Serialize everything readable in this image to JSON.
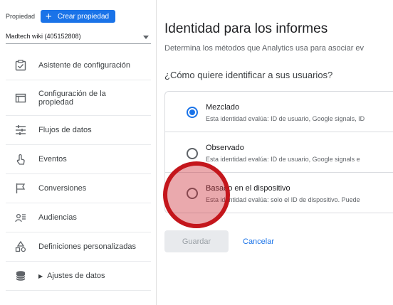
{
  "sidebar": {
    "property_label": "Propiedad",
    "create_property": "Crear propiedad",
    "account": "Madtech wiki (405152808)",
    "items": [
      {
        "label": "Asistente de configuración",
        "icon": "checklist-icon"
      },
      {
        "label": "Configuración de la propiedad",
        "icon": "property-settings-icon"
      },
      {
        "label": "Flujos de datos",
        "icon": "data-streams-icon"
      },
      {
        "label": "Eventos",
        "icon": "events-icon"
      },
      {
        "label": "Conversiones",
        "icon": "flag-icon"
      },
      {
        "label": "Audiencias",
        "icon": "audiences-icon"
      },
      {
        "label": "Definiciones personalizadas",
        "icon": "custom-definitions-icon"
      },
      {
        "label": "Ajustes de datos",
        "icon": "database-icon"
      }
    ]
  },
  "main": {
    "title": "Identidad para los informes",
    "subtitle": "Determina los métodos que Analytics usa para asociar ev",
    "question": "¿Cómo quiere identificar a sus usuarios?",
    "options": [
      {
        "title": "Mezclado",
        "desc": "Esta identidad evalúa: ID de usuario, Google signals, ID",
        "checked": true
      },
      {
        "title": "Observado",
        "desc": "Esta identidad evalúa: ID de usuario, Google signals e",
        "checked": false
      },
      {
        "title": "Basado en el dispositivo",
        "desc": "Esta identidad evalúa: solo el ID de dispositivo. Puede",
        "checked": false
      }
    ],
    "save_label": "Guardar",
    "cancel_label": "Cancelar"
  },
  "colors": {
    "accent": "#1a73e8",
    "click_indicator": "#c4161c"
  }
}
